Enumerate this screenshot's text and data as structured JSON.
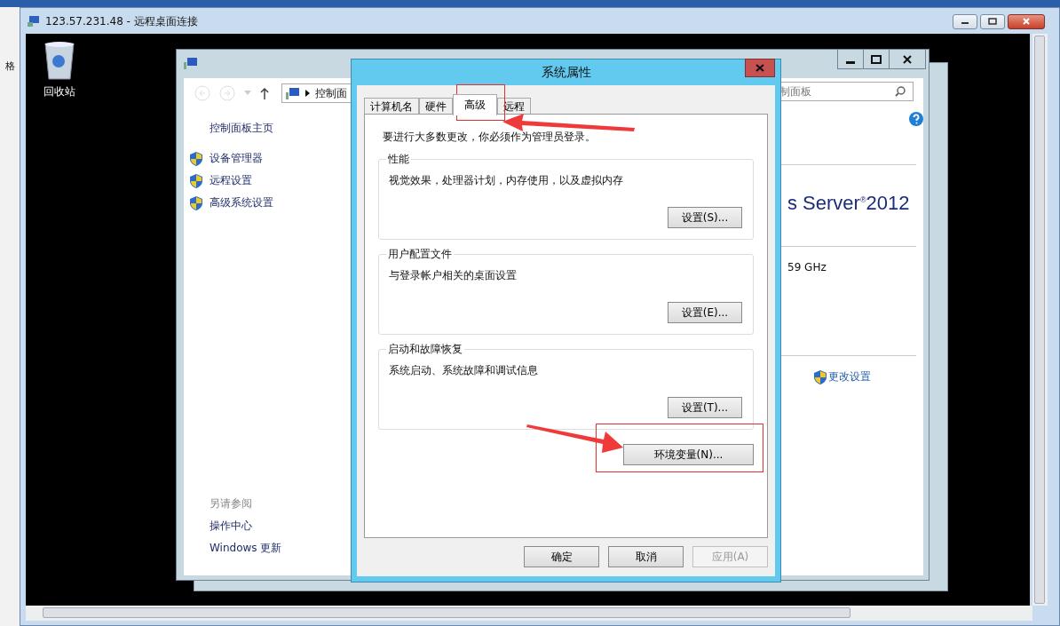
{
  "rdp_window": {
    "title": "123.57.231.48 - 远程桌面连接"
  },
  "left_strip": {
    "text": "格"
  },
  "desktop": {
    "icons": [
      {
        "label": "回收站"
      }
    ]
  },
  "system_window": {
    "address": "控制面",
    "search_placeholder": "制面板",
    "home_link": "控制面板主页",
    "sidebar_items": [
      {
        "label": "设备管理器"
      },
      {
        "label": "远程设置"
      },
      {
        "label": "高级系统设置"
      }
    ],
    "see_also": {
      "title": "另请参阅",
      "links": [
        "操作中心",
        "Windows 更新"
      ]
    },
    "edition": "s Server$^{®}$2012",
    "cpu": "59 GHz",
    "change_settings": "更改设置"
  },
  "dialog": {
    "title": "系统属性",
    "tabs": [
      {
        "label": "计算机名",
        "selected": false
      },
      {
        "label": "硬件",
        "selected": false
      },
      {
        "label": "高级",
        "selected": true
      },
      {
        "label": "远程",
        "selected": false
      }
    ],
    "notice": "要进行大多数更改，你必须作为管理员登录。",
    "groups": [
      {
        "title": "性能",
        "description": "视觉效果，处理器计划，内存使用，以及虚拟内存",
        "button": "设置(S)..."
      },
      {
        "title": "用户配置文件",
        "description": "与登录帐户相关的桌面设置",
        "button": "设置(E)..."
      },
      {
        "title": "启动和故障恢复",
        "description": "系统启动、系统故障和调试信息",
        "button": "设置(T)..."
      }
    ],
    "env_button": "环境变量(N)...",
    "buttons": [
      {
        "label": "确定",
        "disabled": false
      },
      {
        "label": "取消",
        "disabled": false
      },
      {
        "label": "应用(A)",
        "disabled": true
      }
    ]
  }
}
